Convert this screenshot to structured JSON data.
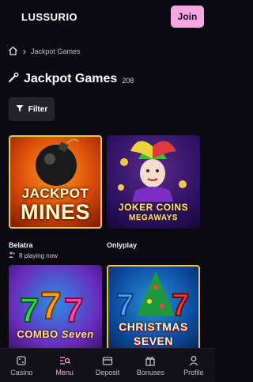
{
  "brand": {
    "logo": "LUSSURIO"
  },
  "header": {
    "join_label": "Join"
  },
  "breadcrumb": {
    "current": "Jackpot Games"
  },
  "page": {
    "title": "Jackpot Games",
    "count": "208",
    "filter_label": "Filter"
  },
  "games": [
    {
      "title_line1": "JACKPOT",
      "title_line2": "MINES",
      "provider": "Belatra",
      "playing": "8 playing now"
    },
    {
      "title_line1": "JOKER COINS",
      "title_line2": "MEGAWAYS",
      "provider": "Onlyplay"
    },
    {
      "title_line1": "COMBO",
      "title_line2": "Seven"
    },
    {
      "title_line1": "CHRISTMAS",
      "title_line2": "SEVEN"
    }
  ],
  "nav": [
    {
      "label": "Casino",
      "icon": "dice-icon"
    },
    {
      "label": "Menu",
      "icon": "search-menu-icon",
      "active": true
    },
    {
      "label": "Deposit",
      "icon": "wallet-icon"
    },
    {
      "label": "Bonuses",
      "icon": "gift-icon"
    },
    {
      "label": "Profile",
      "icon": "user-icon"
    }
  ],
  "colors": {
    "accent": "#f5a7e3",
    "background": "#0b0a10",
    "filter_bg": "#24232c"
  }
}
